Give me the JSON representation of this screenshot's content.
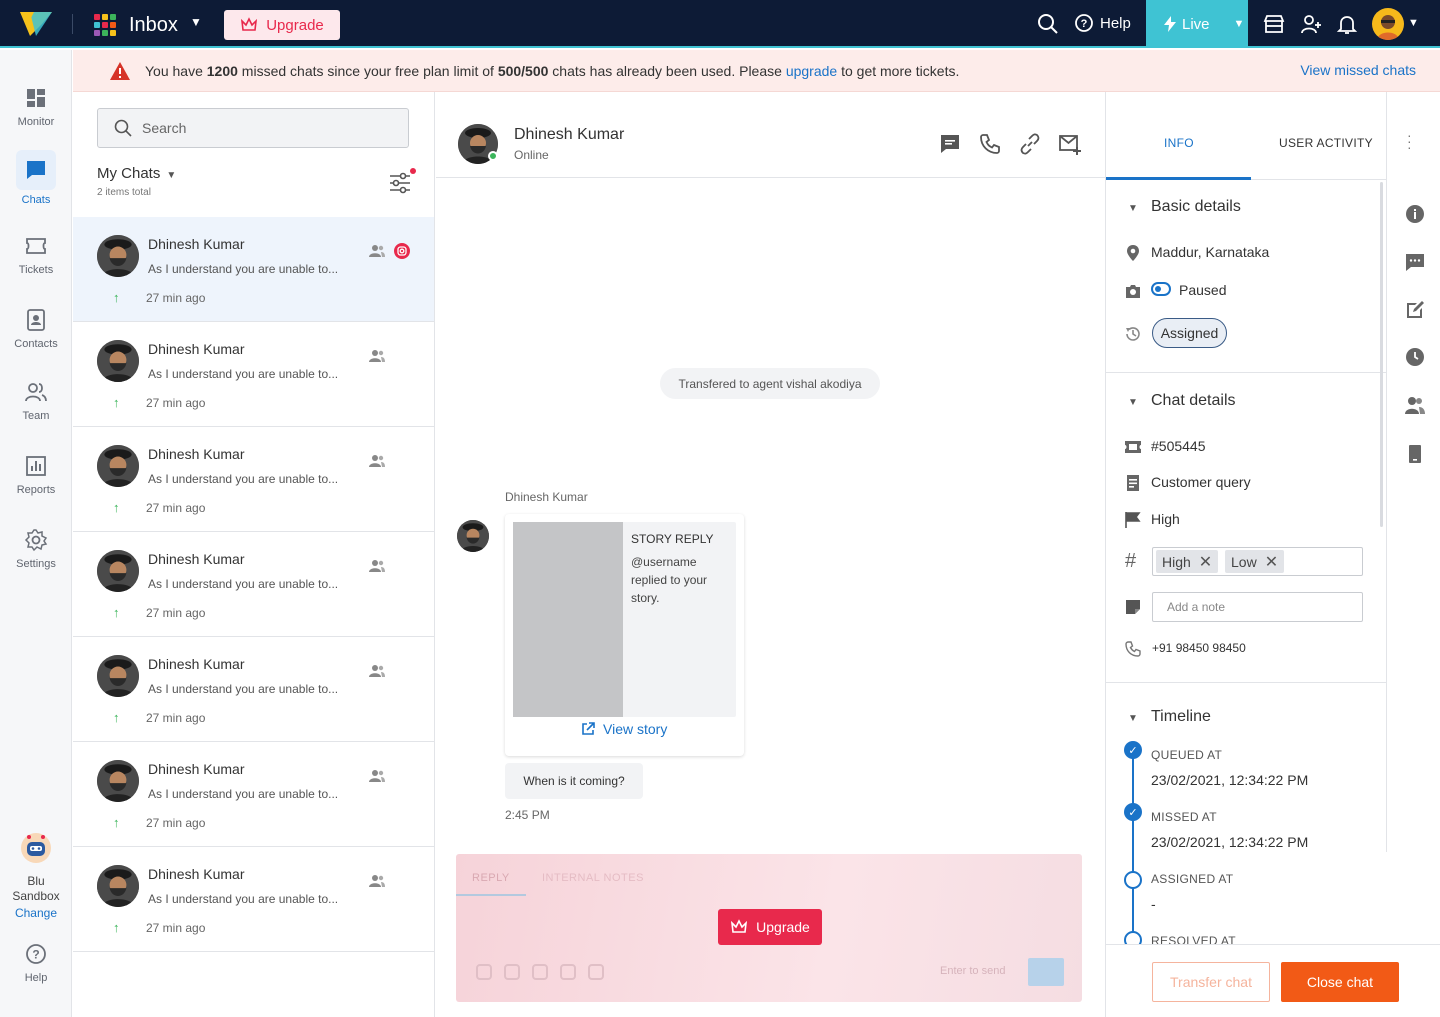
{
  "topbar": {
    "app_title": "Inbox",
    "upgrade_label": "Upgrade",
    "help_label": "Help",
    "live_label": "Live",
    "icons": [
      "search-icon",
      "help-icon",
      "bolt-icon",
      "store-icon",
      "add-user-icon",
      "bell-icon"
    ]
  },
  "nav": {
    "items": [
      {
        "label": "Monitor",
        "icon": "dashboard-icon"
      },
      {
        "label": "Chats",
        "icon": "chat-icon",
        "active": true
      },
      {
        "label": "Tickets",
        "icon": "ticket-icon"
      },
      {
        "label": "Contacts",
        "icon": "contacts-icon"
      },
      {
        "label": "Team",
        "icon": "team-icon"
      },
      {
        "label": "Reports",
        "icon": "reports-icon"
      },
      {
        "label": "Settings",
        "icon": "settings-icon"
      }
    ],
    "sandbox_line1": "Blu",
    "sandbox_line2": "Sandbox",
    "sandbox_change": "Change",
    "help": "Help"
  },
  "banner": {
    "pre": "You have ",
    "count": "1200",
    "mid": " missed chats since your free plan limit of ",
    "limit": "500/500",
    "post": " chats has already been used. Please ",
    "link": "upgrade",
    "end": " to get more tickets.",
    "view_missed": "View missed chats"
  },
  "chatlist": {
    "search_placeholder": "Search",
    "title": "My Chats",
    "count_label": "2 items total",
    "rows": [
      {
        "name": "Dhinesh Kumar",
        "preview": "As I understand you are unable to...",
        "time": "27 min ago",
        "channel": "instagram"
      },
      {
        "name": "Dhinesh Kumar",
        "preview": "As I understand you are unable to...",
        "time": "27 min ago"
      },
      {
        "name": "Dhinesh Kumar",
        "preview": "As I understand you are unable to...",
        "time": "27 min ago"
      },
      {
        "name": "Dhinesh Kumar",
        "preview": "As I understand you are unable to...",
        "time": "27 min ago"
      },
      {
        "name": "Dhinesh Kumar",
        "preview": "As I understand you are unable to...",
        "time": "27 min ago"
      },
      {
        "name": "Dhinesh Kumar",
        "preview": "As I understand you are unable to...",
        "time": "27 min ago"
      },
      {
        "name": "Dhinesh Kumar",
        "preview": "As I understand you are unable to...",
        "time": "27 min ago"
      }
    ]
  },
  "conversation": {
    "contact_name": "Dhinesh Kumar",
    "status": "Online",
    "system_message": "Transfered to agent vishal akodiya",
    "sender": "Dhinesh Kumar",
    "story_title": "STORY REPLY",
    "story_desc": "@username replied to your story.",
    "view_story": "View story",
    "message": "When is it coming?",
    "message_time": "2:45 PM",
    "composer_tab_reply": "REPLY",
    "composer_tab_notes": "INTERNAL NOTES",
    "composer_hint": "Enter to send",
    "upgrade_label": "Upgrade"
  },
  "info": {
    "tab_info": "INFO",
    "tab_activity": "USER ACTIVITY",
    "basic_title": "Basic details",
    "location": "Maddur, Karnataka",
    "paused": "Paused",
    "assigned": "Assigned",
    "chat_title": "Chat details",
    "ticket_id": "#505445",
    "category": "Customer query",
    "priority": "High",
    "tags": [
      "High",
      "Low"
    ],
    "note_placeholder": "Add a note",
    "phone": "+91 98450 98450",
    "timeline_title": "Timeline",
    "timeline": [
      {
        "label": "QUEUED AT",
        "value": "23/02/2021, 12:34:22 PM",
        "done": true
      },
      {
        "label": "MISSED AT",
        "value": "23/02/2021, 12:34:22 PM",
        "done": true
      },
      {
        "label": "ASSIGNED AT",
        "value": "-",
        "done": false
      },
      {
        "label": "RESOLVED AT",
        "value": "",
        "done": false
      }
    ],
    "transfer_label": "Transfer chat",
    "close_label": "Close chat"
  },
  "colors": {
    "primary": "#1a73c8",
    "topbar": "#0d1b36",
    "live": "#3fc3d3",
    "danger": "#e8294c",
    "orange": "#f25a16"
  }
}
